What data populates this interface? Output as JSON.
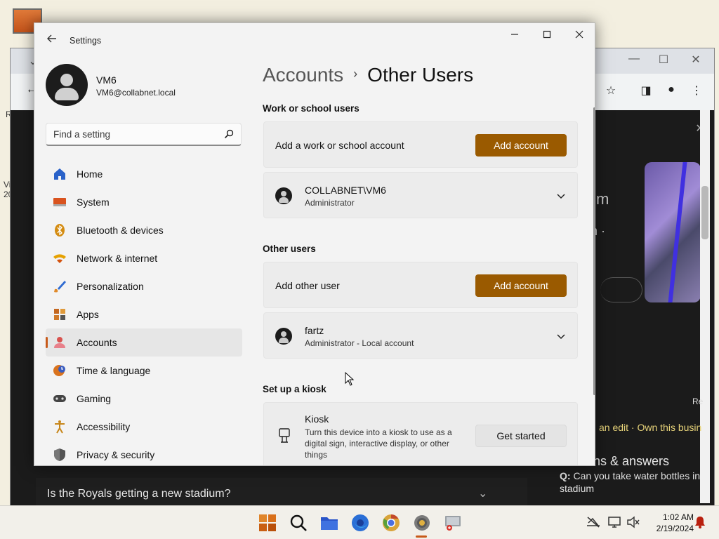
{
  "window": {
    "title": "Settings",
    "back_icon": "back-arrow-icon",
    "minimize_icon": "minimize-icon",
    "maximize_icon": "maximize-icon",
    "close_icon": "close-icon"
  },
  "profile": {
    "name": "VM6",
    "email": "VM6@collabnet.local"
  },
  "search": {
    "placeholder": "Find a setting",
    "icon": "search-icon"
  },
  "nav": {
    "active_index": 6,
    "items": [
      {
        "label": "Home",
        "icon": "home-icon"
      },
      {
        "label": "System",
        "icon": "system-icon"
      },
      {
        "label": "Bluetooth & devices",
        "icon": "bluetooth-icon"
      },
      {
        "label": "Network & internet",
        "icon": "wifi-icon"
      },
      {
        "label": "Personalization",
        "icon": "brush-icon"
      },
      {
        "label": "Apps",
        "icon": "apps-icon"
      },
      {
        "label": "Accounts",
        "icon": "accounts-icon"
      },
      {
        "label": "Time & language",
        "icon": "time-language-icon"
      },
      {
        "label": "Gaming",
        "icon": "gaming-icon"
      },
      {
        "label": "Accessibility",
        "icon": "accessibility-icon"
      },
      {
        "label": "Privacy & security",
        "icon": "shield-icon"
      }
    ]
  },
  "breadcrumb": {
    "parent": "Accounts",
    "separator": "›",
    "current": "Other Users"
  },
  "work_section": {
    "title": "Work or school users",
    "add_label": "Add a work or school account",
    "add_button": "Add account",
    "user": {
      "name": "COLLABNET\\VM6",
      "role": "Administrator"
    }
  },
  "other_section": {
    "title": "Other users",
    "add_label": "Add other user",
    "add_button": "Add account",
    "user": {
      "name": "fartz",
      "role": "Administrator - Local account"
    }
  },
  "kiosk_section": {
    "title": "Set up a kiosk",
    "name": "Kiosk",
    "description": "Turn this device into a kiosk to use as a digital sign, interactive display, or other things",
    "button": "Get started",
    "icon": "kiosk-icon"
  },
  "background_browser": {
    "question": "Is the Royals getting a new stadium?",
    "qa_title": "ons & answers",
    "qa_prefix": "Q:",
    "qa_question": "Can you take water bottles in stadium",
    "edit_text": "an edit · Own this busin",
    "hint_m": "m",
    "hint_n": "n ·",
    "side_label": "Re"
  },
  "taskbar": {
    "apps": [
      "start-icon",
      "search-icon",
      "file-explorer-icon",
      "firefox-icon",
      "chrome-icon",
      "settings-icon",
      "remote-desktop-icon"
    ],
    "time": "1:02 AM",
    "date": "2/19/2024",
    "accent": "#c75a1a"
  },
  "colors": {
    "accent_button": "#9a5a00",
    "window_bg": "#f3f3f3",
    "card_bg": "#ececec"
  }
}
